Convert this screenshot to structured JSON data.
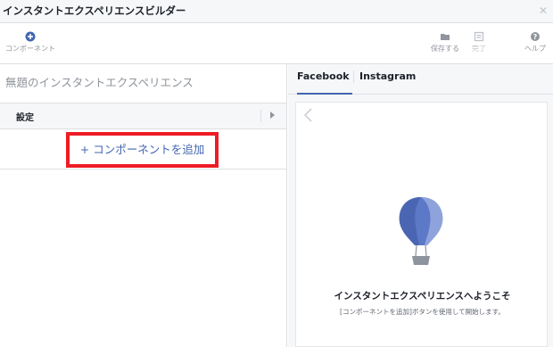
{
  "window": {
    "title": "インスタントエクスペリエンスビルダー",
    "close_icon": "close-icon"
  },
  "toolbar": {
    "component_label": "コンポーネント",
    "save_label": "保存する",
    "done_label": "完了",
    "help_label": "ヘルプ"
  },
  "left_panel": {
    "doc_title": "無題のインスタントエクスペリエンス",
    "settings_label": "設定",
    "add_component_label": "+ コンポーネントを追加"
  },
  "right_panel": {
    "tabs": [
      {
        "label": "Facebook",
        "active": true
      },
      {
        "label": "Instagram",
        "active": false
      }
    ],
    "welcome_title": "インスタントエクスペリエンスへようこそ",
    "welcome_hint": "[コンポーネントを追加]ボタンを使用して開始します。"
  },
  "colors": {
    "accent": "#4267b2",
    "highlight_box": "#ee1c25",
    "balloon": "#5b79c7"
  }
}
